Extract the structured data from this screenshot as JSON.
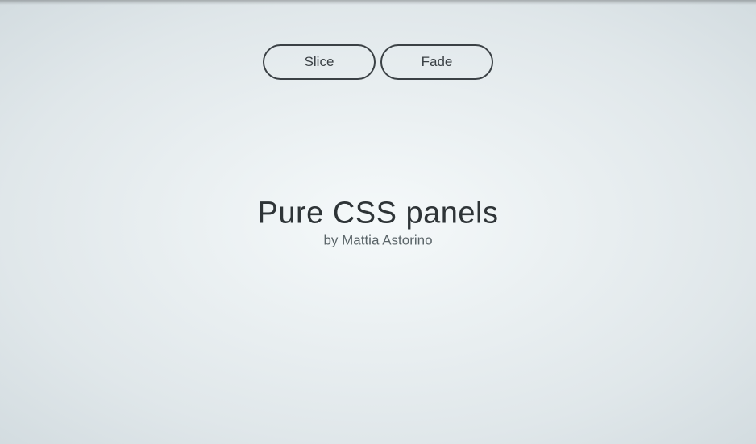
{
  "buttons": {
    "slice": "Slice",
    "fade": "Fade"
  },
  "main": {
    "title": "Pure CSS panels",
    "subtitle": "by Mattia Astorino"
  }
}
